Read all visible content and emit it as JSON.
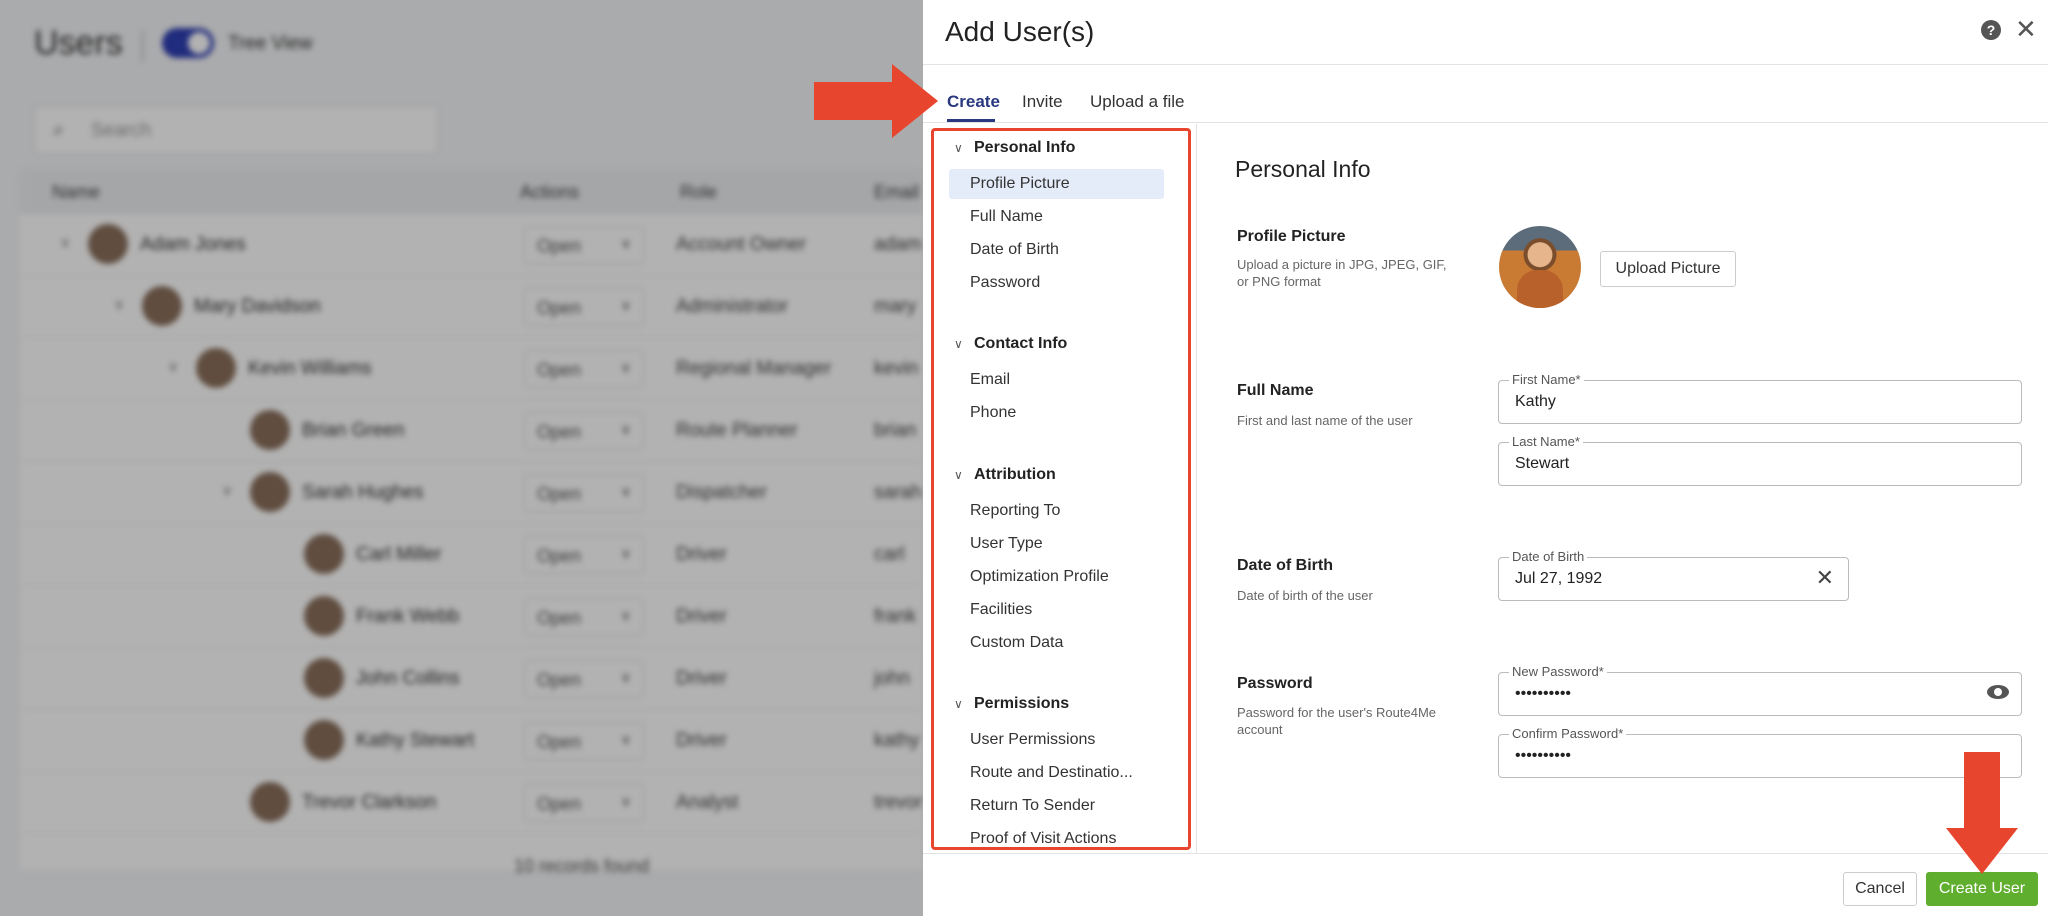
{
  "background": {
    "title": "Users",
    "toggle_label": "Tree View",
    "search_placeholder": "Search",
    "columns": [
      "Name",
      "Actions",
      "Role",
      "Email"
    ],
    "rows": [
      {
        "name": "Adam Jones",
        "action": "Open",
        "role": "Account Owner",
        "email": "adam"
      },
      {
        "name": "Mary Davidson",
        "action": "Open",
        "role": "Administrator",
        "email": "mary"
      },
      {
        "name": "Kevin Williams",
        "action": "Open",
        "role": "Regional Manager",
        "email": "kevin"
      },
      {
        "name": "Brian Green",
        "action": "Open",
        "role": "Route Planner",
        "email": "brian"
      },
      {
        "name": "Sarah Hughes",
        "action": "Open",
        "role": "Dispatcher",
        "email": "sarah"
      },
      {
        "name": "Carl Miller",
        "action": "Open",
        "role": "Driver",
        "email": "carl"
      },
      {
        "name": "Frank Webb",
        "action": "Open",
        "role": "Driver",
        "email": "frank"
      },
      {
        "name": "John Collins",
        "action": "Open",
        "role": "Driver",
        "email": "john"
      },
      {
        "name": "Kathy Stewart",
        "action": "Open",
        "role": "Driver",
        "email": "kathy"
      },
      {
        "name": "Trevor Clarkson",
        "action": "Open",
        "role": "Analyst",
        "email": "trevor"
      }
    ],
    "footer": "10 records found"
  },
  "drawer": {
    "title": "Add User(s)",
    "tabs": [
      {
        "label": "Create",
        "active": true
      },
      {
        "label": "Invite",
        "active": false
      },
      {
        "label": "Upload a file",
        "active": false
      }
    ]
  },
  "nav": {
    "sections": [
      {
        "label": "Personal Info",
        "items": [
          "Profile Picture",
          "Full Name",
          "Date of Birth",
          "Password"
        ]
      },
      {
        "label": "Contact Info",
        "items": [
          "Email",
          "Phone"
        ]
      },
      {
        "label": "Attribution",
        "items": [
          "Reporting To",
          "User Type",
          "Optimization Profile",
          "Facilities",
          "Custom Data"
        ]
      },
      {
        "label": "Permissions",
        "items": [
          "User Permissions",
          "Route and Destinatio...",
          "Return To Sender",
          "Proof of Visit Actions"
        ]
      }
    ],
    "selected": "Profile Picture"
  },
  "form": {
    "title": "Personal Info",
    "profile_picture": {
      "label": "Profile Picture",
      "desc": "Upload a picture in JPG, JPEG, GIF, or PNG format",
      "button": "Upload Picture"
    },
    "full_name": {
      "label": "Full Name",
      "desc": "First and last name of the user",
      "first_legend": "First Name*",
      "first_value": "Kathy",
      "last_legend": "Last Name*",
      "last_value": "Stewart"
    },
    "dob": {
      "label": "Date of Birth",
      "desc": "Date of birth of the user",
      "legend": "Date of Birth",
      "value": "Jul 27, 1992"
    },
    "password": {
      "label": "Password",
      "desc": "Password for the user's Route4Me account",
      "new_legend": "New Password*",
      "new_value": "••••••••••",
      "confirm_legend": "Confirm Password*",
      "confirm_value": "••••••••••"
    }
  },
  "footer": {
    "cancel": "Cancel",
    "create": "Create User"
  },
  "colors": {
    "accent": "#2a3880",
    "annotation": "#e8452e",
    "create_button": "#5fae2e",
    "nav_selected": "#e5ecf9"
  }
}
